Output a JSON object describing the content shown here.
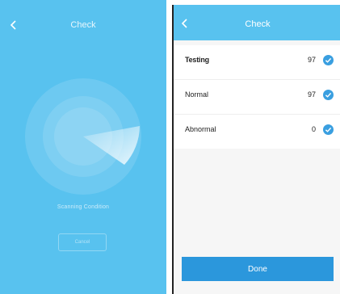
{
  "left_screen": {
    "title": "Check",
    "status_text": "Scanning Condition",
    "cancel_label": "Cancel",
    "icons": {
      "back": "back-chevron-icon"
    },
    "colors": {
      "background": "#58c2ef"
    }
  },
  "right_screen": {
    "title": "Check",
    "icons": {
      "back": "back-chevron-icon",
      "check": "check-circle-icon"
    },
    "rows": [
      {
        "label": "Testing",
        "value": "97"
      },
      {
        "label": "Normal",
        "value": "97"
      },
      {
        "label": "Abnormal",
        "value": "0"
      }
    ],
    "done_label": "Done",
    "colors": {
      "header": "#58c2ef",
      "done_button": "#2b97dc",
      "check": "#3a9fe0"
    }
  }
}
